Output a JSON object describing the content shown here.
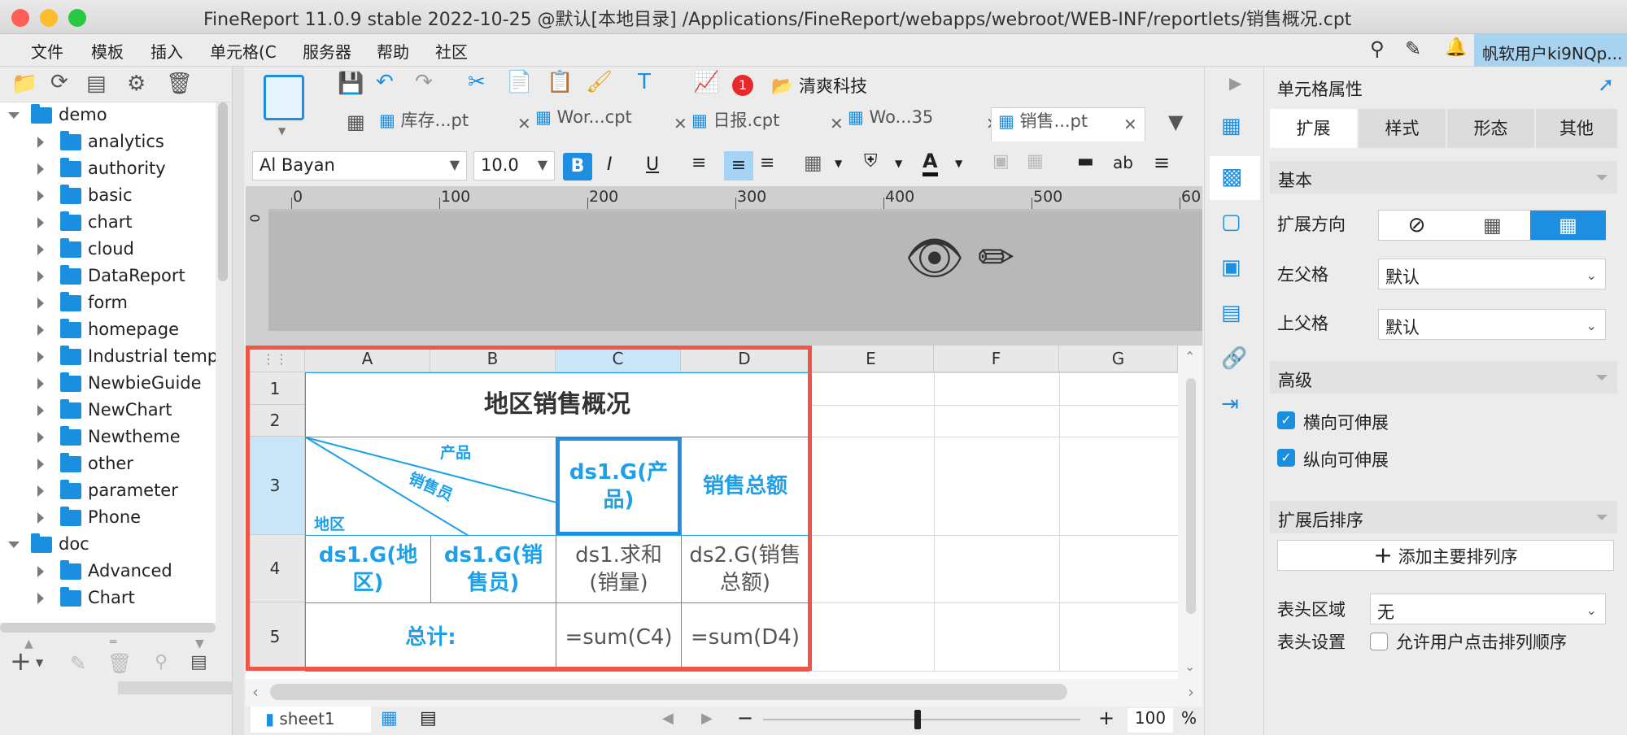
{
  "window": {
    "title": "FineReport 11.0.9 stable 2022-10-25 @默认[本地目录]   /Applications/FineReport/webapps/webroot/WEB-INF/reportlets/销售概况.cpt"
  },
  "menu": {
    "items": [
      "文件",
      "模板",
      "插入",
      "单元格(C",
      "服务器",
      "帮助",
      "社区"
    ],
    "user": "帆软用户ki9NQp..."
  },
  "tree": {
    "items": [
      {
        "label": "demo",
        "level": 0,
        "open": true
      },
      {
        "label": "analytics",
        "level": 1
      },
      {
        "label": "authority",
        "level": 1
      },
      {
        "label": "basic",
        "level": 1
      },
      {
        "label": "chart",
        "level": 1
      },
      {
        "label": "cloud",
        "level": 1
      },
      {
        "label": "DataReport",
        "level": 1
      },
      {
        "label": "form",
        "level": 1
      },
      {
        "label": "homepage",
        "level": 1
      },
      {
        "label": "Industrial temp",
        "level": 1
      },
      {
        "label": "NewbieGuide",
        "level": 1
      },
      {
        "label": "NewChart",
        "level": 1
      },
      {
        "label": "Newtheme",
        "level": 1
      },
      {
        "label": "other",
        "level": 1
      },
      {
        "label": "parameter",
        "level": 1
      },
      {
        "label": "Phone",
        "level": 1
      },
      {
        "label": "doc",
        "level": 0,
        "open": true
      },
      {
        "label": "Advanced",
        "level": 1
      },
      {
        "label": "Chart",
        "level": 1
      }
    ]
  },
  "toolbar": {
    "company": "清爽科技",
    "badge": "1"
  },
  "tabs": [
    {
      "label": "库存...pt"
    },
    {
      "label": "Wor...cpt"
    },
    {
      "label": "日报.cpt"
    },
    {
      "label": "Wo...35"
    },
    {
      "label": "销售...pt"
    }
  ],
  "format": {
    "font": "Al Bayan",
    "size": "10.0",
    "bold": "B",
    "italic": "I",
    "underline": "U",
    "text_icon": "ab"
  },
  "ruler": {
    "ticks": [
      "0",
      "100",
      "200",
      "300",
      "400",
      "500",
      "60"
    ],
    "vtick": "0"
  },
  "grid": {
    "columns": [
      "A",
      "B",
      "C",
      "D",
      "E",
      "F",
      "G"
    ],
    "rows": [
      "1",
      "2",
      "3",
      "4",
      "5"
    ],
    "title": "地区销售概况",
    "diag": {
      "top": "产品",
      "mid": "销售员",
      "bottom": "地区"
    },
    "c3": "ds1.G(产品)",
    "d3": "销售总额",
    "a4": "ds1.G(地区)",
    "b4": "ds1.G(销售员)",
    "c4": "ds1.求和(销量)",
    "d4": "ds2.G(销售总额)",
    "a5": "总计:",
    "c5": "=sum(C4)",
    "d5": "=sum(D4)"
  },
  "bottom": {
    "sheet": "sheet1",
    "zoom": "100",
    "pct": "%",
    "minus": "−",
    "plus": "+"
  },
  "props": {
    "header": "单元格属性",
    "tabs": [
      "扩展",
      "样式",
      "形态",
      "其他"
    ],
    "basic": "基本",
    "expand_dir": "扩展方向",
    "left_parent": "左父格",
    "left_parent_val": "默认",
    "top_parent": "上父格",
    "top_parent_val": "默认",
    "advanced": "高级",
    "h_expand": "横向可伸展",
    "v_expand": "纵向可伸展",
    "sort": "扩展后排序",
    "add_sort": "添加主要排列序",
    "header_area": "表头区域",
    "header_area_val": "无",
    "header_setting": "表头设置",
    "allow_sort": "允许用户点击排列顺序"
  },
  "colors": {
    "accent": "#1ea0e8",
    "highlight": "#f05545"
  }
}
